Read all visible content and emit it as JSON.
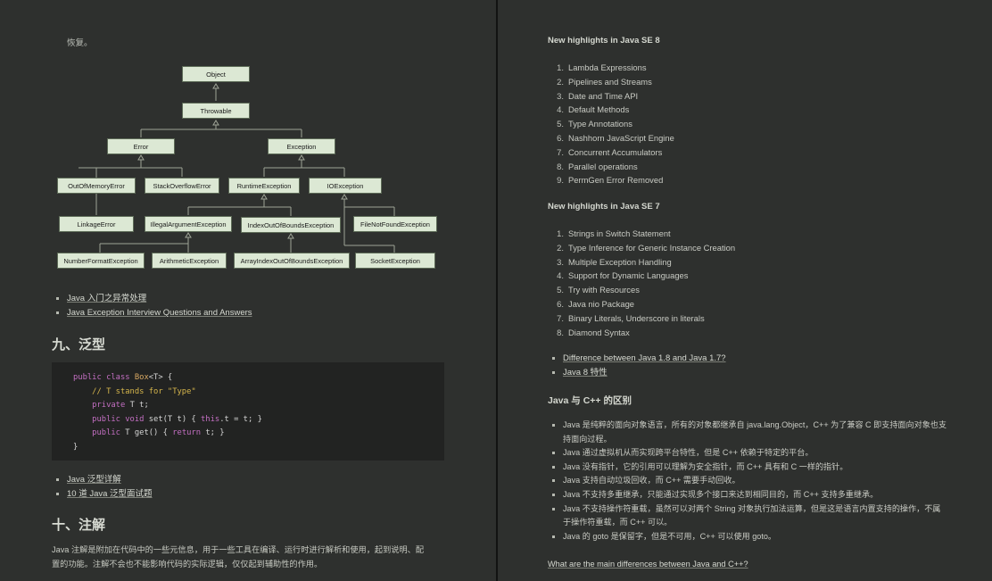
{
  "left": {
    "intro_text": "恢复。",
    "hierarchy": {
      "object": "Object",
      "throwable": "Throwable",
      "error": "Error",
      "exception": "Exception",
      "out_of_memory": "OutOfMemoryError",
      "stack_overflow": "StackOverflowError",
      "runtime_exception": "RuntimeException",
      "io_exception": "IOException",
      "linkage_error": "LinkageError",
      "illegal_argument": "IllegalArgumentException",
      "index_out_of_bounds": "IndexOutOfBoundsException",
      "file_not_found": "FileNotFoundException",
      "number_format": "NumberFormatException",
      "arithmetic": "ArithmeticException",
      "array_index": "ArrayIndexOutOfBoundsException",
      "socket": "SocketException"
    },
    "exception_links": [
      "Java 入门之异常处理",
      "Java Exception Interview Questions and Answers"
    ],
    "generics_heading": "九、泛型",
    "code": {
      "l1_kw": "public class ",
      "l1_name": "Box",
      "l1_rest": "<T> {",
      "l2": "    // T stands for \"Type\"",
      "l3_kw": "    private ",
      "l3_rest": "T t;",
      "l4_kw": "    public ",
      "l4_void": "void ",
      "l4_fn": "set(T t) { ",
      "l4_this": "this",
      "l4_rest": ".t = t; }",
      "l5_kw": "    public ",
      "l5_fn": "T get() { ",
      "l5_ret": "return ",
      "l5_rest": "t; }",
      "l6": "}"
    },
    "generics_links": [
      "Java 泛型详解",
      "10 道 Java 泛型面试题"
    ],
    "annotation_heading": "十、注解",
    "annotation_line1": "Java 注解是附加在代码中的一些元信息，用于一些工具在编译、运行时进行解析和使用，起到说明、配",
    "annotation_line2": "置的功能。注解不会也不能影响代码的实际逻辑，仅仅起到辅助性的作用。"
  },
  "right": {
    "se8_heading": "New highlights in Java SE 8",
    "se8_items": [
      {
        "n": "1.",
        "t": "Lambda Expressions"
      },
      {
        "n": "2.",
        "t": "Pipelines and Streams"
      },
      {
        "n": "3.",
        "t": "Date and Time API"
      },
      {
        "n": "4.",
        "t": "Default Methods"
      },
      {
        "n": "5.",
        "t": "Type Annotations"
      },
      {
        "n": "6.",
        "t": "Nashhorn JavaScript Engine"
      },
      {
        "n": "7.",
        "t": "Concurrent Accumulators"
      },
      {
        "n": "8.",
        "t": "Parallel operations"
      },
      {
        "n": "9.",
        "t": "PermGen Error Removed"
      }
    ],
    "se7_heading": "New highlights in Java SE 7",
    "se7_items": [
      {
        "n": "1.",
        "t": "Strings in Switch Statement"
      },
      {
        "n": "2.",
        "t": "Type Inference for Generic Instance Creation"
      },
      {
        "n": "3.",
        "t": "Multiple Exception Handling"
      },
      {
        "n": "4.",
        "t": "Support for Dynamic Languages"
      },
      {
        "n": "5.",
        "t": "Try with Resources"
      },
      {
        "n": "6.",
        "t": "Java nio Package"
      },
      {
        "n": "7.",
        "t": "Binary Literals, Underscore in literals"
      },
      {
        "n": "8.",
        "t": "Diamond Syntax"
      }
    ],
    "version_links": [
      "Difference between Java 1.8 and Java 1.7?",
      "Java 8 特性"
    ],
    "cpp_heading": "Java 与 C++ 的区别",
    "cpp_items": [
      "Java 是纯粹的面向对象语言，所有的对象都继承自 java.lang.Object，C++ 为了兼容 C 即支持面向对象也支持面向过程。",
      "Java 通过虚拟机从而实现跨平台特性，但是 C++ 依赖于特定的平台。",
      "Java 没有指针，它的引用可以理解为安全指针，而 C++ 具有和 C 一样的指针。",
      "Java 支持自动垃圾回收，而 C++ 需要手动回收。",
      "Java 不支持多重继承，只能通过实现多个接口来达到相同目的，而 C++ 支持多重继承。",
      "Java 不支持操作符重载，虽然可以对两个 String 对象执行加法运算，但是这是语言内置支持的操作，不属于操作符重载，而 C++ 可以。",
      "Java 的 goto 是保留字，但是不可用，C++ 可以使用 goto。"
    ],
    "cpp_link": "What are the main differences between Java and C++?"
  }
}
